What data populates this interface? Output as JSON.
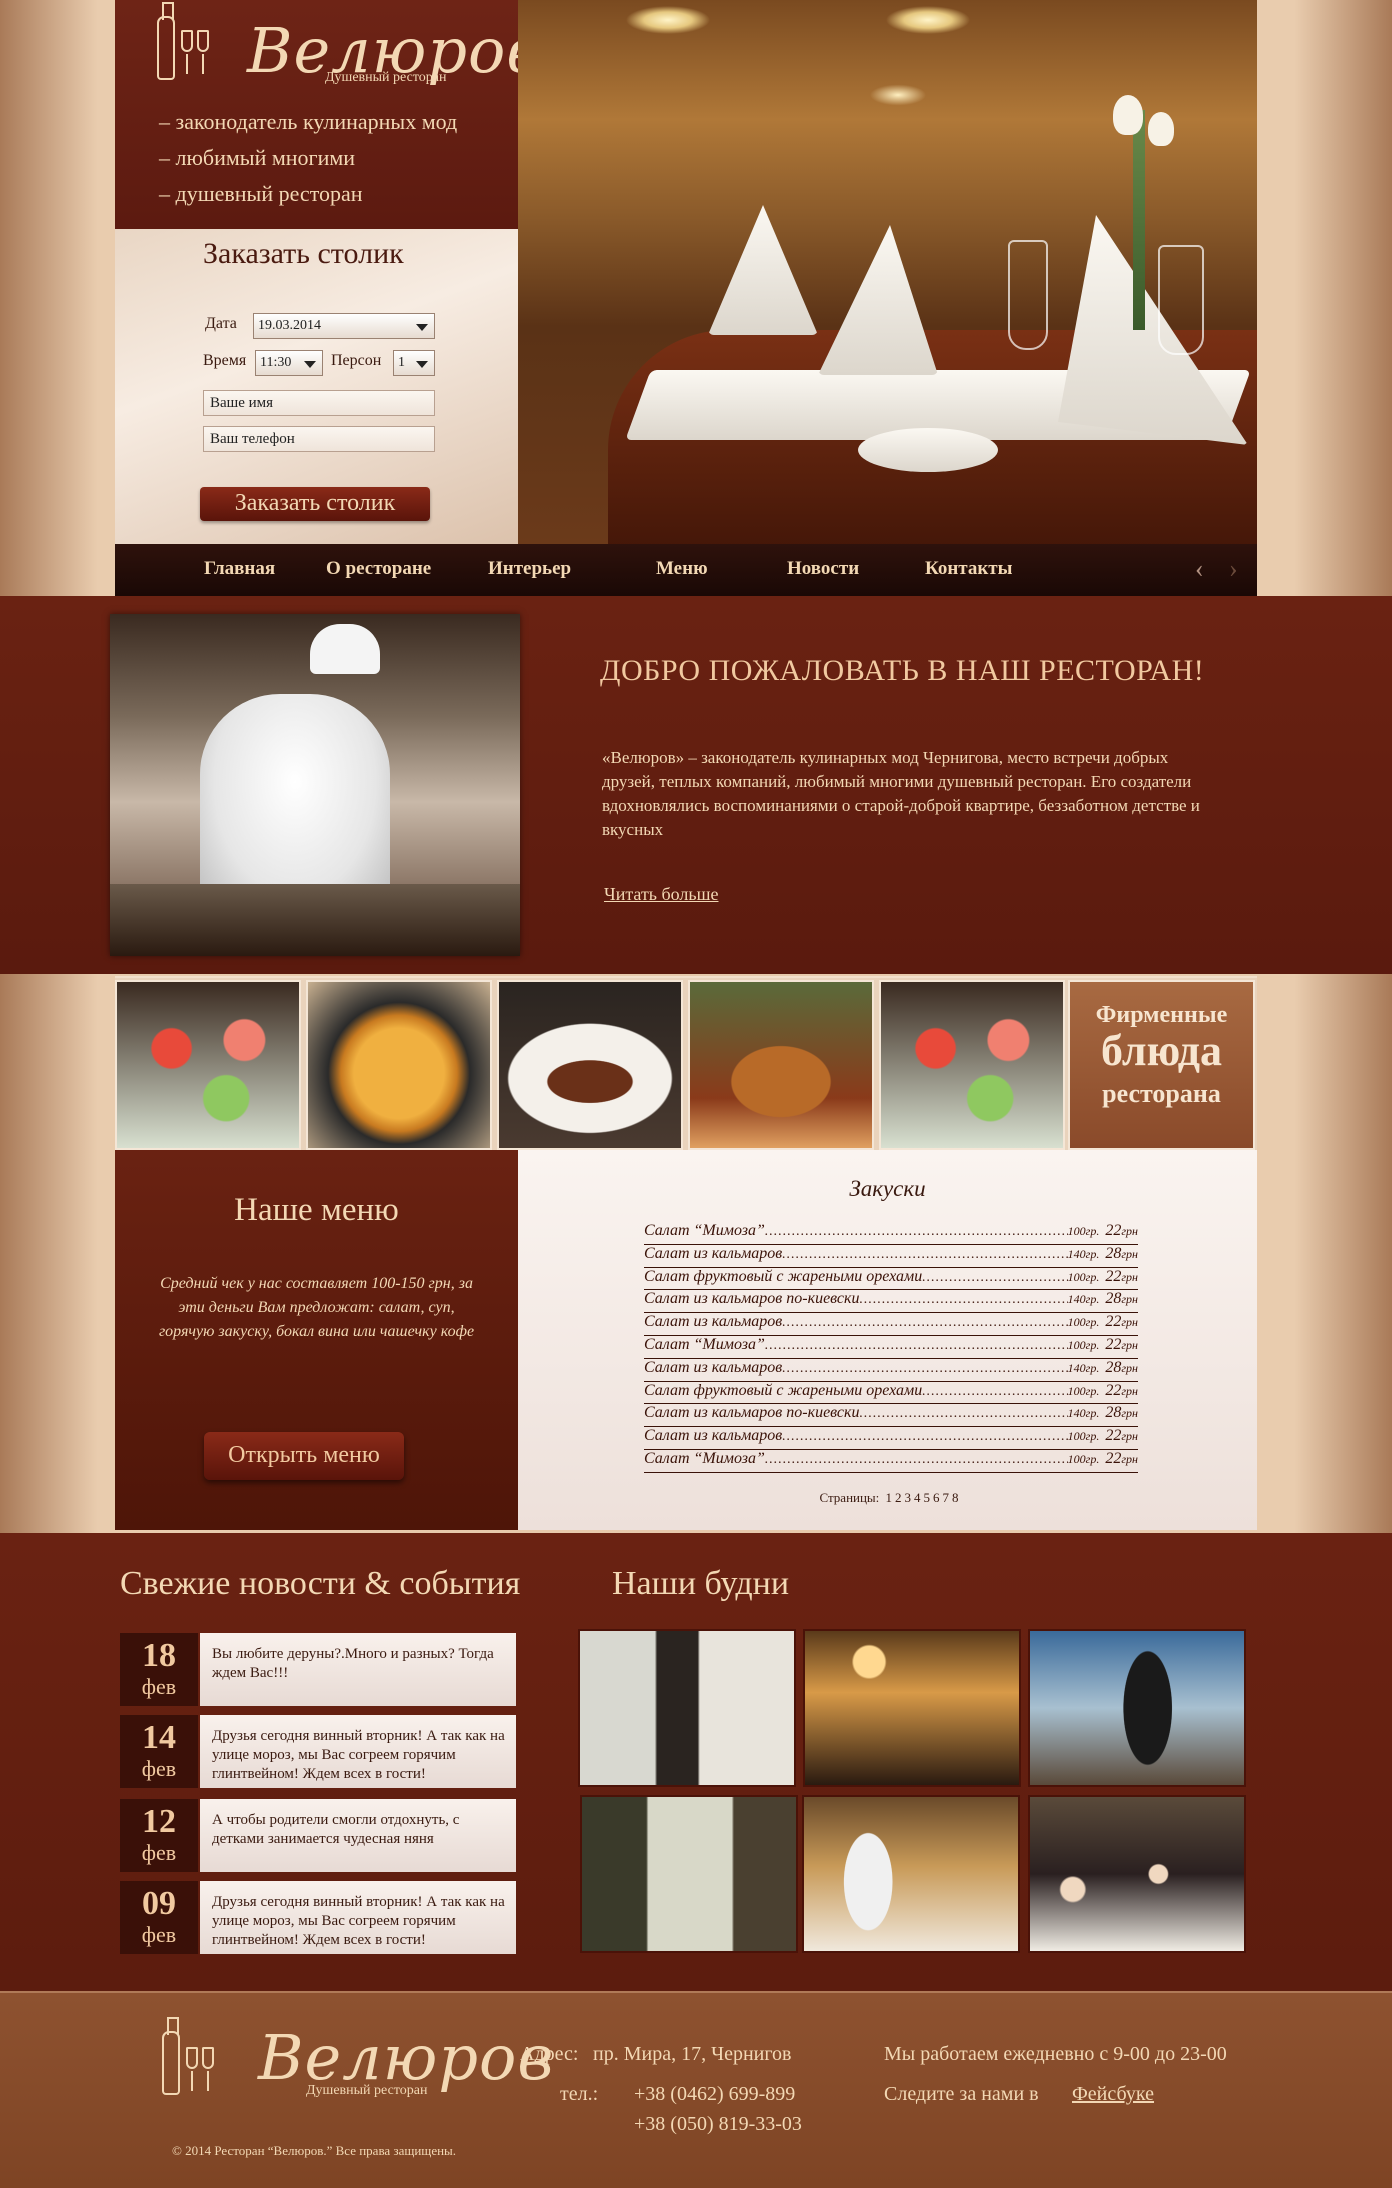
{
  "brand": {
    "name": "Велюров",
    "subtitle": "Душевный ресторан",
    "taglines": [
      "– законодатель кулинарных мод",
      "– любимый многими",
      "– душевный ресторан"
    ]
  },
  "booking": {
    "title": "Заказать столик",
    "date_label": "Дата",
    "date_value": "19.03.2014",
    "time_label": "Время",
    "time_value": "11:30",
    "persons_label": "Персон",
    "persons_value": "1",
    "name_value": "Ваше имя",
    "phone_value": "Ваш телефон",
    "submit_label": "Заказать столик"
  },
  "nav": {
    "items": [
      "Главная",
      "О ресторане",
      "Интерьер",
      "Меню",
      "Новости",
      "Контакты"
    ],
    "prev": "‹",
    "next": "›"
  },
  "welcome": {
    "title": "ДОБРО ПОЖАЛОВАТЬ В НАШ РЕСТОРАН!",
    "text": "«Велюров» – законодатель кулинарных мод Чернигова, место встречи добрых друзей, теплых компаний, любимый многими душевный ресторан. Его создатели вдохновлялись воспоминаниями о старой-доброй квартире, беззаботном детстве и вкусных",
    "read_more": "Читать больше"
  },
  "signature": {
    "line1": "Фирменные",
    "line2": "блюда",
    "line3": "ресторана"
  },
  "menu": {
    "title": "Наше меню",
    "description": "Средний чек у нас составляет 100-150 грн, за эти деньги Вам предложат: салат, суп, горячую закуску, бокал вина или чашечку кофе",
    "open_label": "Открыть меню",
    "category": "Закуски",
    "items": [
      {
        "name": "Салат “Мимоза”",
        "weight": "100гр.",
        "price": "22",
        "currency": "грн"
      },
      {
        "name": "Салат из кальмаров",
        "weight": "140гр.",
        "price": "28",
        "currency": "грн"
      },
      {
        "name": "Салат фруктовый с жареными орехами",
        "weight": "100гр.",
        "price": "22",
        "currency": "грн"
      },
      {
        "name": "Салат из кальмаров по-киевски",
        "weight": "140гр.",
        "price": "28",
        "currency": "грн"
      },
      {
        "name": "Салат из кальмаров",
        "weight": "100гр.",
        "price": "22",
        "currency": "грн"
      },
      {
        "name": "Салат “Мимоза”",
        "weight": "100гр.",
        "price": "22",
        "currency": "грн"
      },
      {
        "name": "Салат из кальмаров",
        "weight": "140гр.",
        "price": "28",
        "currency": "грн"
      },
      {
        "name": "Салат фруктовый с жареными орехами",
        "weight": "100гр.",
        "price": "22",
        "currency": "грн"
      },
      {
        "name": "Салат из кальмаров по-киевски",
        "weight": "140гр.",
        "price": "28",
        "currency": "грн"
      },
      {
        "name": "Салат из кальмаров",
        "weight": "100гр.",
        "price": "22",
        "currency": "грн"
      },
      {
        "name": "Салат “Мимоза”",
        "weight": "100гр.",
        "price": "22",
        "currency": "грн"
      }
    ],
    "pages_label": "Страницы:",
    "pages": [
      "1",
      "2",
      "3",
      "4",
      "5",
      "6",
      "7",
      "8"
    ]
  },
  "news": {
    "title": "Свежие новости & события",
    "items": [
      {
        "day": "18",
        "month": "фев",
        "text": "Вы любите деруны?.Много и разных? Тогда ждем Вас!!!"
      },
      {
        "day": "14",
        "month": "фев",
        "text": "Друзья сегодня винный вторник! А так как на улице мороз, мы Вас согреем горячим глинтвейном! Ждем всех в гости!"
      },
      {
        "day": "12",
        "month": "фев",
        "text": "А чтобы родители смогли отдохнуть, с детками занимается чудесная няня"
      },
      {
        "day": "09",
        "month": "фев",
        "text": "Друзья сегодня винный вторник! А так как на улице мороз, мы Вас согреем горячим глинтвейном! Ждем всех в гости!"
      }
    ]
  },
  "gallery": {
    "title": "Наши будни"
  },
  "footer": {
    "address_label": "Адрес:",
    "address": "пр. Мира, 17, Чернигов",
    "phone_label": "тел.:",
    "phone1": "+38 (0462) 699-899",
    "phone2": "+38 (050) 819-33-03",
    "hours": "Мы работаем ежедневно с 9-00 до 23-00",
    "follow": "Следите за нами в",
    "facebook": "Фейсбуке",
    "copyright": "©  2014 Ресторан “Велюров.” Все права защищены."
  },
  "colors": {
    "maroon": "#5c1a10",
    "cream": "#f3d8b4",
    "footer": "#8e5230"
  }
}
